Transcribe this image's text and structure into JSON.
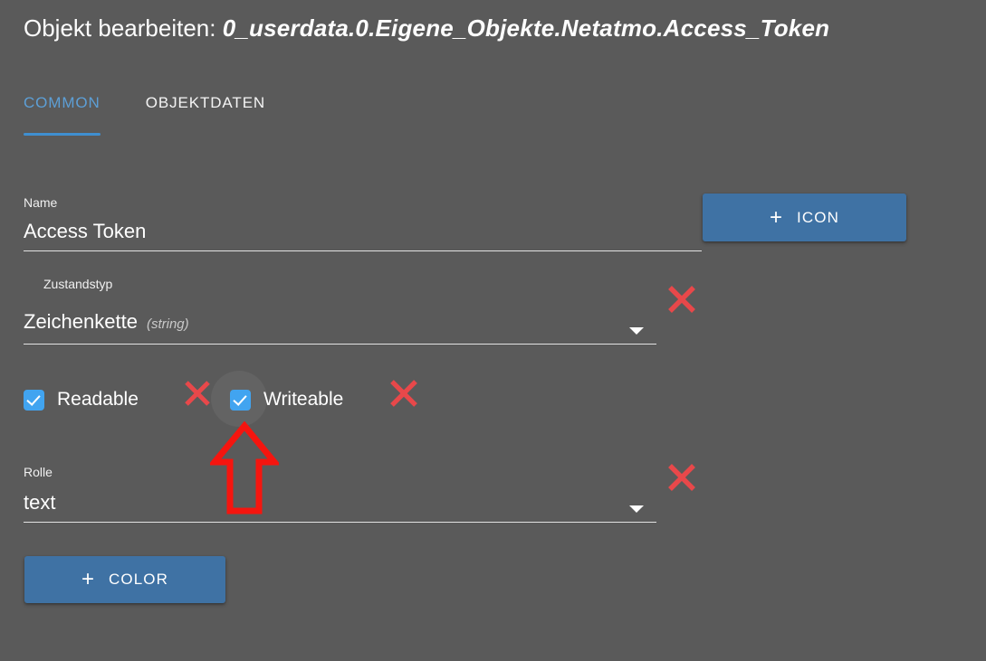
{
  "window": {
    "background_color": "#5a5a5a",
    "accent_color": "#3f8fd0",
    "button_color": "#3f72a4",
    "checkbox_color": "#41a4f0",
    "annotation_color": "#e8484a"
  },
  "title": {
    "prefix": "Objekt bearbeiten: ",
    "path": "0_userdata.0.Eigene_Objekte.Netatmo.Access_Token"
  },
  "tabs": [
    {
      "label": "COMMON",
      "active": true
    },
    {
      "label": "OBJEKTDATEN",
      "active": false
    }
  ],
  "form": {
    "name": {
      "label": "Name",
      "value": "Access Token"
    },
    "state_type": {
      "label": "Zustandstyp",
      "value": "Zeichenkette",
      "value_suffix": "(string)",
      "caret_icon": "chevron-down-icon"
    },
    "readable": {
      "label": "Readable",
      "checked": true
    },
    "writeable": {
      "label": "Writeable",
      "checked": true
    },
    "role": {
      "label": "Rolle",
      "value": "text",
      "caret_icon": "chevron-down-icon"
    }
  },
  "buttons": {
    "icon": {
      "plus": "+",
      "label": "ICON",
      "icon": "plus-icon"
    },
    "color": {
      "plus": "+",
      "label": "COLOR",
      "icon": "plus-icon"
    }
  },
  "annotations": {
    "x_marks": [
      {
        "name": "x-mark-statetype"
      },
      {
        "name": "x-mark-readable"
      },
      {
        "name": "x-mark-writeable"
      },
      {
        "name": "x-mark-role"
      }
    ],
    "arrow": {
      "name": "arrow-up-annotation",
      "points_to": "writeable-checkbox"
    }
  }
}
